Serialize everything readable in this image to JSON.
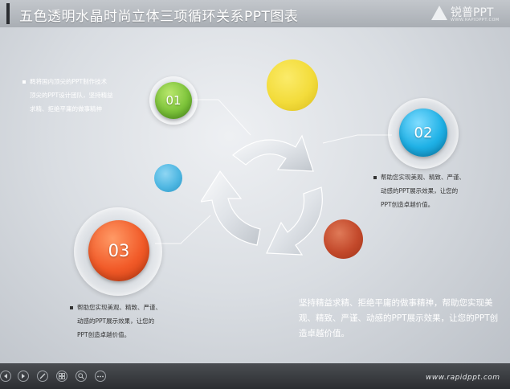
{
  "title": "五色透明水晶时尚立体三项循环关系PPT图表",
  "logo": {
    "text": "锐普PPT",
    "sub": "WWW.RAPIDPPT.COM"
  },
  "circles": {
    "one": {
      "number": "01",
      "color": "#7dc43a"
    },
    "two": {
      "number": "02",
      "color": "#1fb1e6"
    },
    "three": {
      "number": "03",
      "color": "#f15a28"
    },
    "yellow": {
      "color": "#f3dc3b"
    },
    "blue": {
      "color": "#4fb7e2"
    },
    "red": {
      "color": "#c3492b"
    }
  },
  "texts": {
    "top_left": [
      "羁将国内顶尖的PPT制作技术",
      "顶尖的PPT设计团队，坚持精益",
      "求精、拒绝平庸的做事精神"
    ],
    "right": [
      "帮助您实现美观、精致、严谨、",
      "动感的PPT展示效果，让您的",
      "PPT创造卓越价值。"
    ],
    "bottom_left": [
      "帮助您实现美观、精致、严谨、",
      "动感的PPT展示效果，让您的",
      "PPT创造卓越价值。"
    ],
    "main": "坚持精益求精、拒绝平庸的做事精神，帮助您实现美观、精致、严谨、动感的PPT展示效果，让您的PPT创造卓越价值。"
  },
  "footer": {
    "website": "www.rapidppt.com"
  }
}
